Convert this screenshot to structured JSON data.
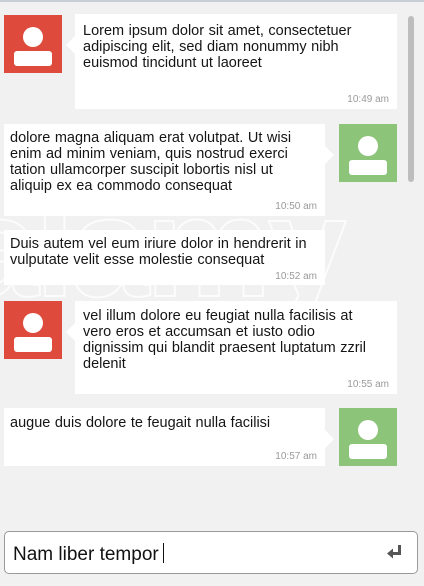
{
  "watermark": "alamy",
  "messages": [
    {
      "side": "left",
      "avatar_color": "#de4a3c",
      "lines": [
        "Lorem ipsum dolor sit amet, consectetuer",
        "adipiscing elit, sed diam nonummy nibh",
        "euismod tincidunt ut laoreet"
      ],
      "time": "10:49 am"
    },
    {
      "side": "right",
      "avatar_color": "#8cc57a",
      "lines": [
        "dolore magna aliquam erat volutpat. Ut wisi",
        "enim ad minim veniam, quis nostrud exerci",
        "tation ullamcorper suscipit lobortis nisl ut",
        "aliquip ex ea commodo consequat"
      ],
      "time": "10:50 am"
    },
    {
      "side": "none",
      "lines": [
        "Duis autem vel eum iriure dolor in hendrerit in",
        "vulputate velit esse molestie consequat"
      ],
      "time": "10:52 am"
    },
    {
      "side": "left",
      "avatar_color": "#de4a3c",
      "lines": [
        "vel illum dolore eu feugiat nulla facilisis at",
        "vero eros et accumsan et iusto odio",
        "dignissim qui blandit praesent luptatum zzril",
        "delenit"
      ],
      "time": "10:55 am"
    },
    {
      "side": "right",
      "avatar_color": "#8cc57a",
      "lines": [
        "augue duis dolore te feugait nulla facilisi"
      ],
      "time": "10:57 am"
    }
  ],
  "composer": {
    "value": "Nam liber tempor",
    "send_icon": "enter-return-icon"
  }
}
